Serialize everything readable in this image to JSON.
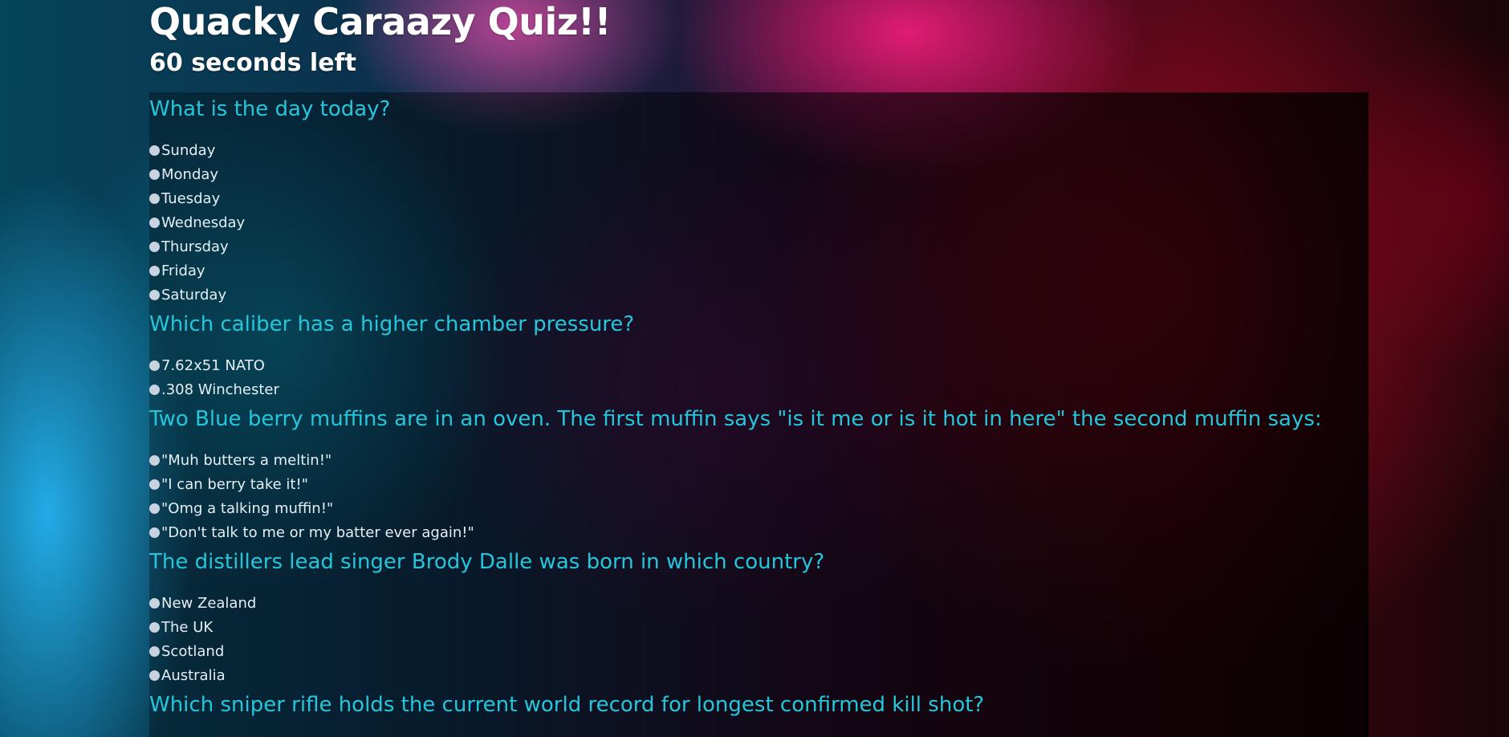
{
  "header": {
    "title": "Quacky Caraazy Quiz!!",
    "timer": "60 seconds left"
  },
  "questions": [
    {
      "text": "What is the day today?",
      "options": [
        "Sunday",
        "Monday",
        "Tuesday",
        "Wednesday",
        "Thursday",
        "Friday",
        "Saturday"
      ]
    },
    {
      "text": "Which caliber has a higher chamber pressure?",
      "options": [
        "7.62x51 NATO",
        ".308 Winchester"
      ]
    },
    {
      "text": "Two Blue berry muffins are in an oven. The first muffin says \"is it me or is it hot in here\" the second muffin says:",
      "options": [
        "\"Muh butters a meltin!\"",
        "\"I can berry take it!\"",
        "\"Omg a talking muffin!\"",
        "\"Don't talk to me or my batter ever again!\""
      ]
    },
    {
      "text": "The distillers lead singer Brody Dalle was born in which country?",
      "options": [
        "New Zealand",
        "The UK",
        "Scotland",
        "Australia"
      ]
    },
    {
      "text": "Which sniper rifle holds the current world record for longest confirmed kill shot?",
      "options": []
    }
  ]
}
